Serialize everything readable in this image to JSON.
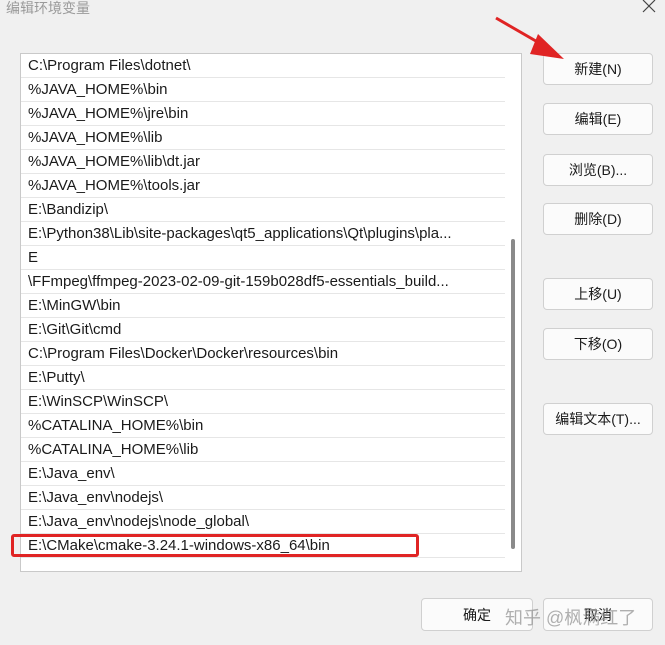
{
  "window": {
    "title": "编辑环境变量",
    "close_icon": "close-icon"
  },
  "path_list": {
    "items": [
      "C:\\Program Files\\dotnet\\",
      "%JAVA_HOME%\\bin",
      "%JAVA_HOME%\\jre\\bin",
      "%JAVA_HOME%\\lib",
      "%JAVA_HOME%\\lib\\dt.jar",
      "%JAVA_HOME%\\tools.jar",
      "E:\\Bandizip\\",
      "E:\\Python38\\Lib\\site-packages\\qt5_applications\\Qt\\plugins\\pla...",
      "E",
      "\\FFmpeg\\ffmpeg-2023-02-09-git-159b028df5-essentials_build...",
      "E:\\MinGW\\bin",
      "E:\\Git\\Git\\cmd",
      "C:\\Program Files\\Docker\\Docker\\resources\\bin",
      "E:\\Putty\\",
      "E:\\WinSCP\\WinSCP\\",
      "%CATALINA_HOME%\\bin",
      "%CATALINA_HOME%\\lib",
      "E:\\Java_env\\",
      "E:\\Java_env\\nodejs\\",
      "E:\\Java_env\\nodejs\\node_global\\",
      "E:\\CMake\\cmake-3.24.1-windows-x86_64\\bin"
    ],
    "selected_index": 20
  },
  "buttons": {
    "new": "新建(N)",
    "edit": "编辑(E)",
    "browse": "浏览(B)...",
    "delete": "删除(D)",
    "move_up": "上移(U)",
    "move_down": "下移(O)",
    "edit_text": "编辑文本(T)...",
    "ok": "确定",
    "cancel": "取消"
  },
  "annotations": {
    "highlight_color": "#e02424",
    "arrow_color": "#e02424"
  },
  "watermark": "知乎 @枫满红了"
}
